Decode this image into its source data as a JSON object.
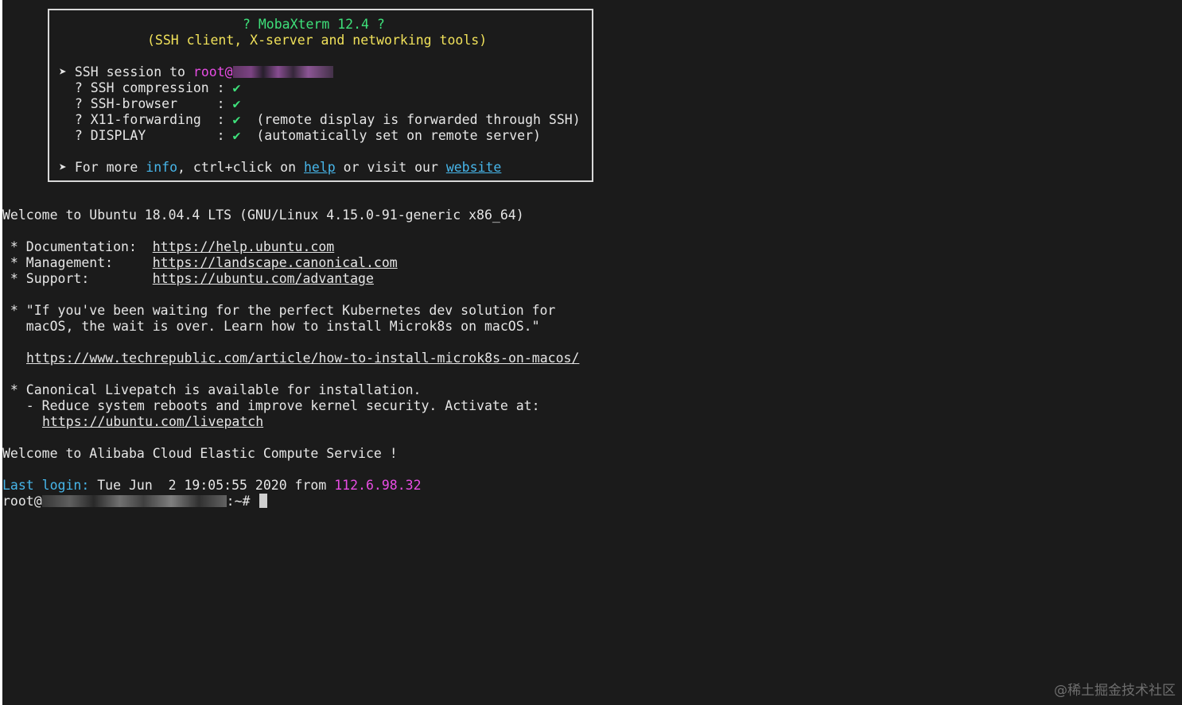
{
  "banner": {
    "title": "? MobaXterm 12.4 ?",
    "subtitle": "(SSH client, X-server and networking tools)",
    "ssh_prefix": "➤ SSH session to ",
    "ssh_user": "root@",
    "options": [
      {
        "label": "  ? SSH compression : ",
        "check": "✔",
        "note": ""
      },
      {
        "label": "  ? SSH-browser     : ",
        "check": "✔",
        "note": ""
      },
      {
        "label": "  ? X11-forwarding  : ",
        "check": "✔",
        "note": "  (remote display is forwarded through SSH)"
      },
      {
        "label": "  ? DISPLAY         : ",
        "check": "✔",
        "note": "  (automatically set on remote server)"
      }
    ],
    "more_prefix": "➤ For more ",
    "more_info": "info",
    "more_mid": ", ctrl+click on ",
    "more_help": "help",
    "more_or": " or visit our ",
    "more_website": "website"
  },
  "motd": {
    "welcome": "Welcome to Ubuntu 18.04.4 LTS (GNU/Linux 4.15.0-91-generic x86_64)",
    "doc_label": " * Documentation:  ",
    "doc_url": "https://help.ubuntu.com",
    "mgmt_label": " * Management:     ",
    "mgmt_url": "https://landscape.canonical.com",
    "support_label": " * Support:        ",
    "support_url": "https://ubuntu.com/advantage",
    "k8s_line1": " * \"If you've been waiting for the perfect Kubernetes dev solution for",
    "k8s_line2": "   macOS, the wait is over. Learn how to install Microk8s on macOS.\"",
    "k8s_url": "https://www.techrepublic.com/article/how-to-install-microk8s-on-macos/",
    "livepatch_line1": " * Canonical Livepatch is available for installation.",
    "livepatch_line2": "   - Reduce system reboots and improve kernel security. Activate at:",
    "livepatch_url": "https://ubuntu.com/livepatch",
    "alibaba": "Welcome to Alibaba Cloud Elastic Compute Service !"
  },
  "last_login": {
    "label": "Last login:",
    "date": " Tue Jun  2 19:05:55 2020 from ",
    "ip": "112.6.98.32"
  },
  "prompt": {
    "user": "root@",
    "suffix": ":~#"
  },
  "watermark": "@稀土掘金技术社区"
}
